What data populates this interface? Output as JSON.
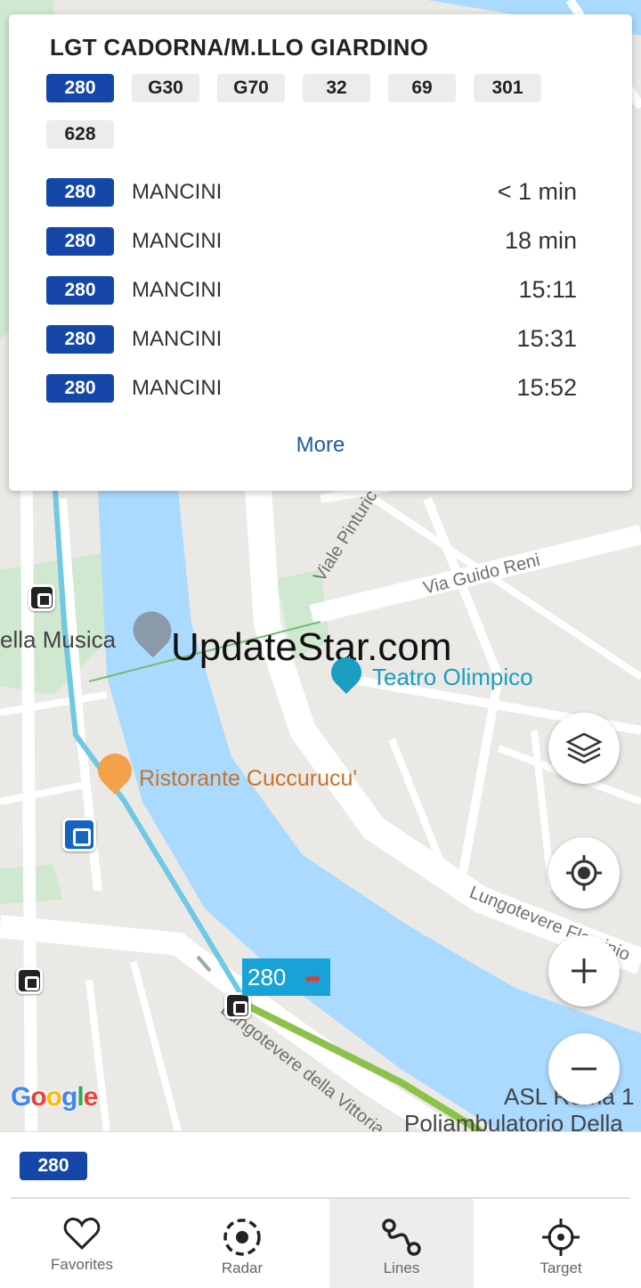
{
  "stop": {
    "name": "LGT CADORNA/M.LLO GIARDINO",
    "lines": [
      "280",
      "G30",
      "G70",
      "32",
      "69",
      "301",
      "628"
    ],
    "selected_line": "280"
  },
  "departures": [
    {
      "line": "280",
      "destination": "MANCINI",
      "time": "< 1 min"
    },
    {
      "line": "280",
      "destination": "MANCINI",
      "time": "18 min"
    },
    {
      "line": "280",
      "destination": "MANCINI",
      "time": "15:11"
    },
    {
      "line": "280",
      "destination": "MANCINI",
      "time": "15:31"
    },
    {
      "line": "280",
      "destination": "MANCINI",
      "time": "15:52"
    }
  ],
  "more_label": "More",
  "map": {
    "labels": {
      "music": "ella Musica",
      "theater": "Teatro Olimpico",
      "restaurant": "Ristorante Cuccurucu'",
      "viale_pinturicchio": "Viale Pinturic",
      "via_guido_reni": "Via Guido Reni",
      "lungotevere_flaminio": "Lungotevere Flaminio",
      "lungotevere_vittoria": "Lungotevere della Vittoria",
      "asl": "ASL Roma 1",
      "poliambulatorio": "Poliambulatorio Della",
      "google": "Google"
    },
    "watermark": "UpdateStar.com",
    "bus_tag": "280",
    "colors": {
      "river": "#aadaff",
      "route_blue": "#5bc0de",
      "route_green": "#8bc34a",
      "park": "#c8e6c9"
    }
  },
  "route_strip": {
    "line": "280"
  },
  "nav": [
    {
      "label": "Favorites",
      "icon": "heart-icon",
      "selected": false
    },
    {
      "label": "Radar",
      "icon": "radar-icon",
      "selected": false
    },
    {
      "label": "Lines",
      "icon": "route-icon",
      "selected": true
    },
    {
      "label": "Target",
      "icon": "crosshair-icon",
      "selected": false
    }
  ]
}
